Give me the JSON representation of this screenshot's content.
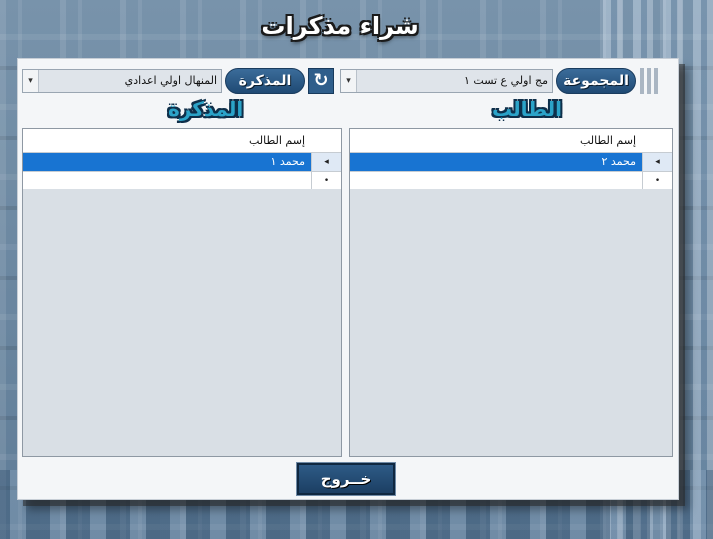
{
  "window": {
    "title": "شراء مذكرات"
  },
  "colors": {
    "accent": "#1874d2",
    "pill": "#2a5a88",
    "section_title": "#2ba3c8",
    "panel": "#f4f6f8",
    "grid_bg": "#d9dfe5"
  },
  "filters": {
    "group_label": "المجموعة",
    "group_value": "مج اولي ع تست ١",
    "memo_label": "المذكرة",
    "memo_value": "المنهال اولي اعدادي",
    "refresh_icon": "↻"
  },
  "sections": {
    "students_title": "الطالب",
    "memo_title": "المذكرة"
  },
  "students_grid": {
    "column_header": "إسم الطالب",
    "rows": [
      {
        "name": "محمد ٢",
        "row_marker": "◂"
      }
    ],
    "new_row_marker": "•"
  },
  "memo_grid": {
    "column_header": "إسم الطالب",
    "rows": [
      {
        "name": "محمد ١",
        "row_marker": "◂"
      }
    ],
    "new_row_marker": "•"
  },
  "footer": {
    "exit_label": "خــروج"
  }
}
